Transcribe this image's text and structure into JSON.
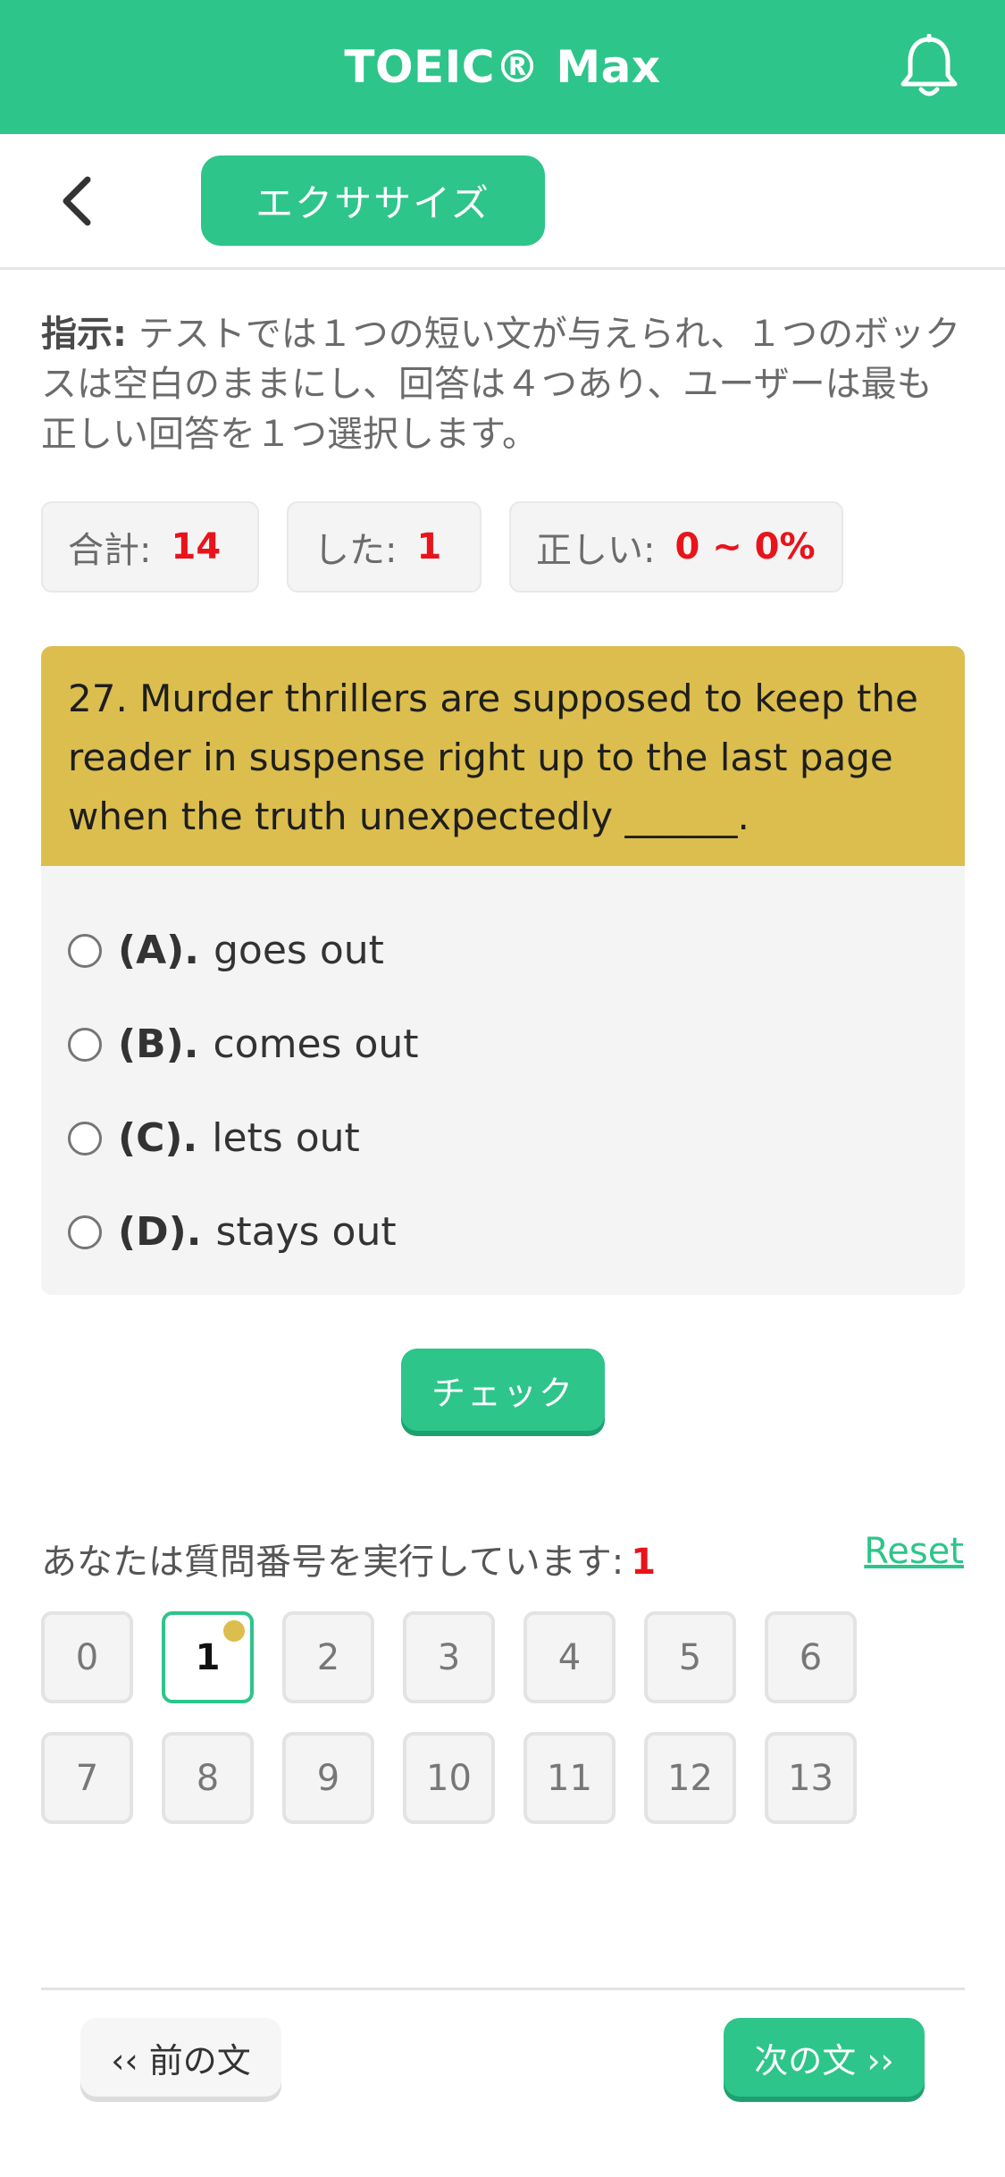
{
  "header": {
    "title": "TOEIC® Max",
    "notification_icon": "bell-icon"
  },
  "subbar": {
    "back_icon": "chevron-left-icon",
    "tab_label": "エクササイズ"
  },
  "instructions": {
    "label": "指示:",
    "text": " テストでは１つの短い文が与えられ、１つのボックスは空白のままにし、回答は４つあり、ユーザーは最も正しい回答を１つ選択します。"
  },
  "stats": {
    "total_label": "合計:",
    "total_value": "14",
    "done_label": "した:",
    "done_value": "1",
    "correct_label": "正しい:",
    "correct_value": "0 ~ 0%"
  },
  "question": {
    "text": "27. Murder thrillers are supposed to keep the reader in suspense right up to the last page when the truth unexpectedly ______.",
    "options": [
      {
        "letter": "(A).",
        "text": "goes out"
      },
      {
        "letter": "(B).",
        "text": "comes out"
      },
      {
        "letter": "(C).",
        "text": "lets out"
      },
      {
        "letter": "(D).",
        "text": "stays out"
      }
    ]
  },
  "check_label": "チェック",
  "progress": {
    "running_label": "あなたは質問番号を実行しています:",
    "current": "1",
    "reset_label": "Reset",
    "numbers": [
      "0",
      "1",
      "2",
      "3",
      "4",
      "5",
      "6",
      "7",
      "8",
      "9",
      "10",
      "11",
      "12",
      "13"
    ]
  },
  "footer": {
    "prev_label": "‹‹ 前の文",
    "next_label": "次の文 ››"
  },
  "colors": {
    "accent": "#2dc58a",
    "question_bg": "#dcbe4e",
    "highlight": "#e8141c"
  }
}
